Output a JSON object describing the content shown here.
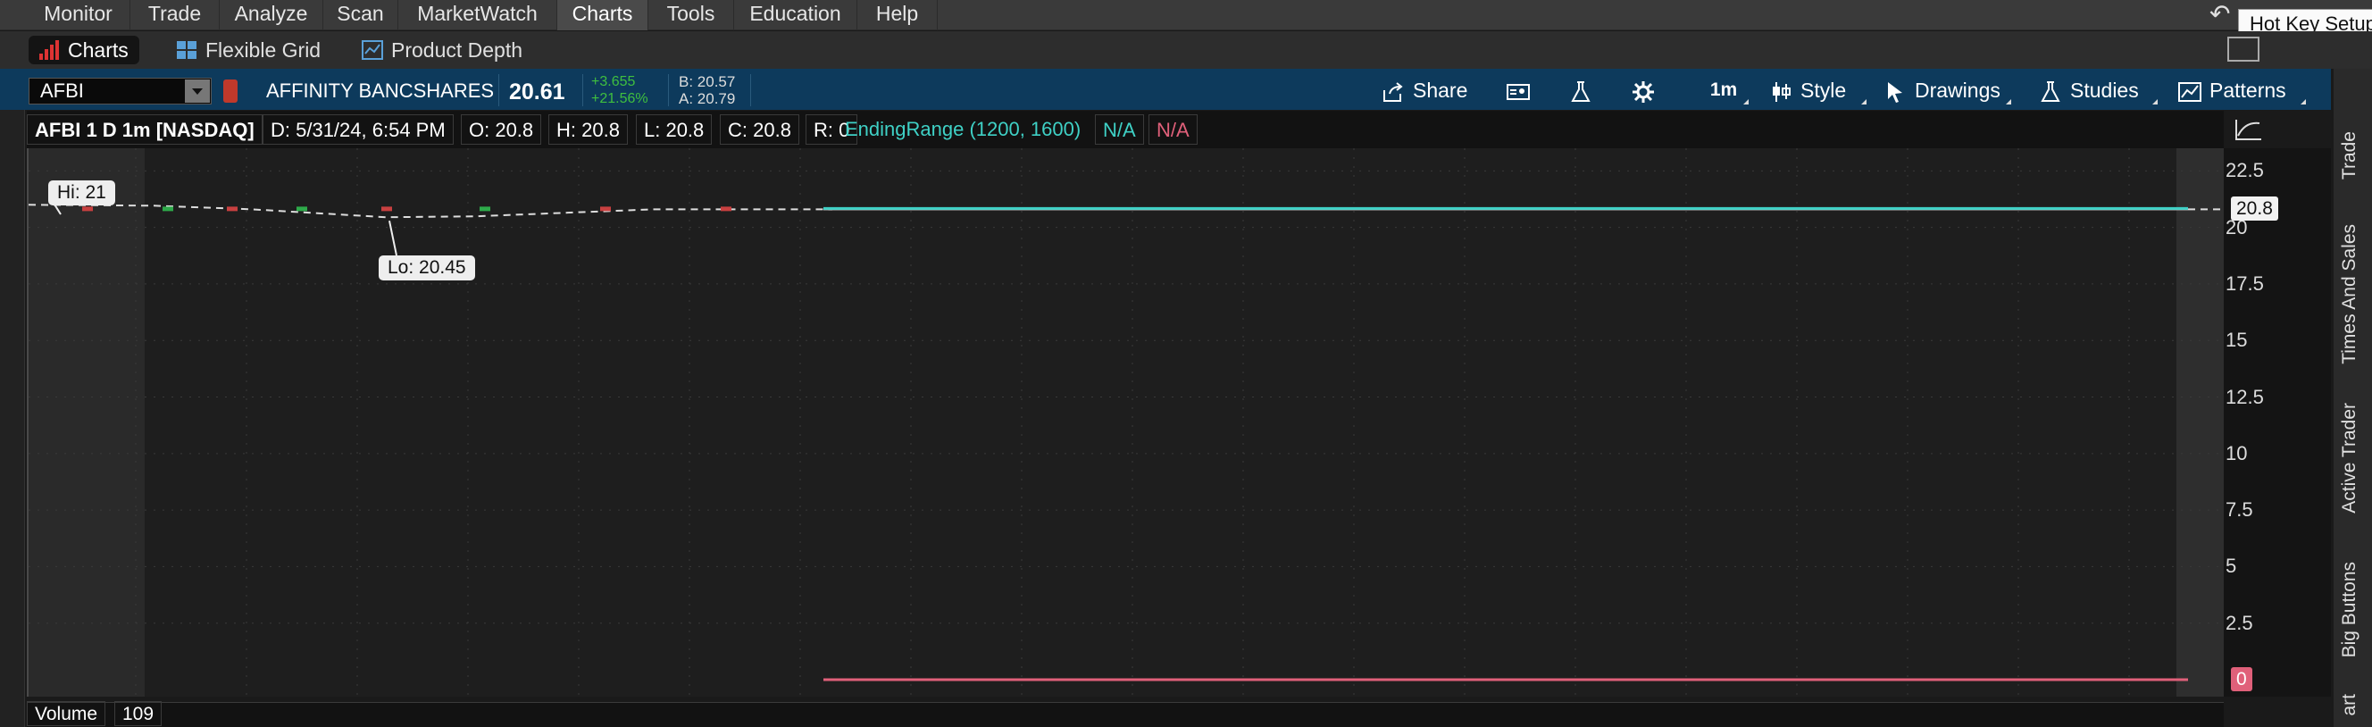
{
  "menu": {
    "items": [
      "Monitor",
      "Trade",
      "Analyze",
      "Scan",
      "MarketWatch",
      "Charts",
      "Tools",
      "Education",
      "Help"
    ],
    "active": "Charts"
  },
  "tooltip": {
    "hotkey": "Hot Key Setup"
  },
  "subtabs": [
    {
      "label": "Charts",
      "icon": "bar-chart-icon",
      "active": true
    },
    {
      "label": "Flexible Grid",
      "icon": "grid-icon",
      "active": false
    },
    {
      "label": "Product Depth",
      "icon": "depth-icon",
      "active": false
    }
  ],
  "symbol": {
    "ticker": "AFBI",
    "company": "AFFINITY BANCSHARES",
    "last": "20.61",
    "net_change": "+3.655",
    "net_pct": "+21.56%",
    "bid": "B: 20.57",
    "ask": "A: 20.79"
  },
  "toolbar": {
    "share": "Share",
    "timeframe": "1m",
    "style": "Style",
    "drawings": "Drawings",
    "studies": "Studies",
    "patterns": "Patterns"
  },
  "infobar": {
    "title": "AFBI 1 D 1m [NASDAQ]",
    "date": "D: 5/31/24, 6:54 PM",
    "open": "O: 20.8",
    "high": "H: 20.8",
    "low": "L: 20.8",
    "close": "C: 20.8",
    "range": "R: 0",
    "study": "EndingRange (1200, 1600)",
    "na1": "N/A",
    "na2": "N/A"
  },
  "chart_data": {
    "type": "line",
    "series": [
      {
        "values": [
          20.8,
          20.8,
          20.8,
          20.8,
          20.8
        ]
      }
    ],
    "ylim": [
      -0.75,
      23.5
    ],
    "ticks": [
      "22.5",
      "20",
      "17.5",
      "15",
      "12.5",
      "10",
      "7.5",
      "5",
      "2.5"
    ],
    "hi_label": "Hi: 21",
    "lo_label": "Lo: 20.45",
    "hi": 21,
    "lo": 20.45,
    "price_marker": "20.8",
    "zero_marker": "0",
    "grid": true
  },
  "sidebar": {
    "tabs": [
      "Trade",
      "Times And Sales",
      "Active Trader",
      "Big Buttons",
      "art"
    ]
  },
  "volume": {
    "label": "Volume",
    "value": "109"
  },
  "colors": {
    "study_line": "#3fd1c6",
    "zero_line": "#e0607a",
    "up": "#2eaa4a",
    "down": "#c84040",
    "header_blue": "#0d3a5c"
  }
}
